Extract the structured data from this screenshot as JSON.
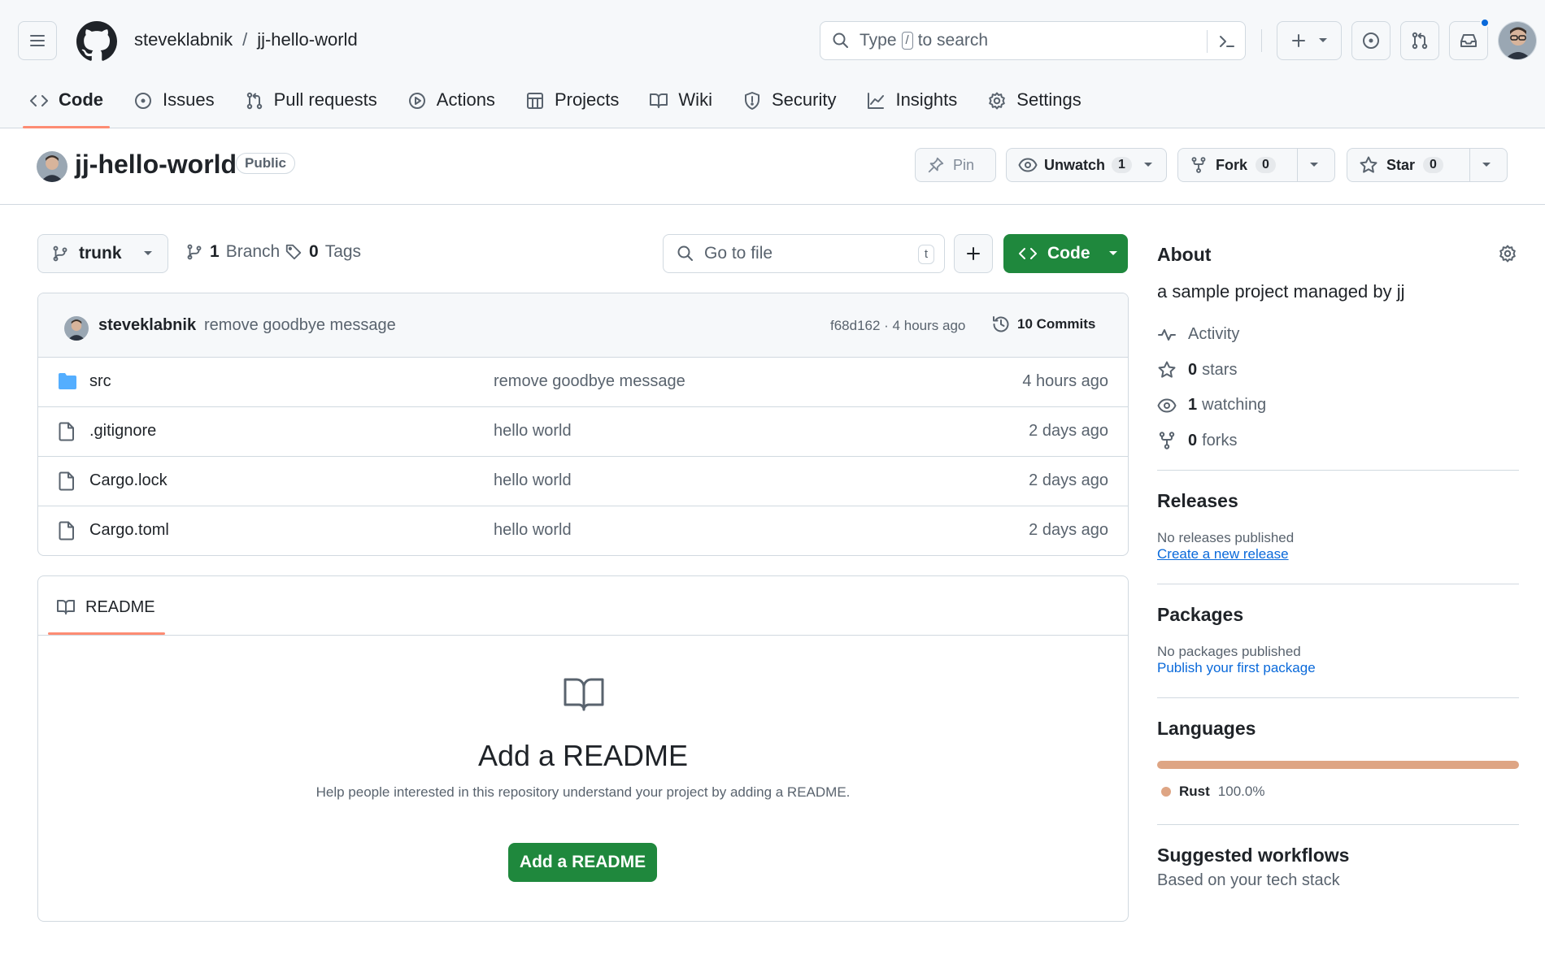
{
  "header": {
    "owner": "steveklabnik",
    "separator": "/",
    "repo": "jj-hello-world",
    "search": {
      "prefix": "Type",
      "key": "/",
      "suffix": "to search"
    }
  },
  "nav": {
    "items": [
      {
        "label": "Code",
        "icon": "code-icon",
        "active": true
      },
      {
        "label": "Issues",
        "icon": "issue-icon"
      },
      {
        "label": "Pull requests",
        "icon": "pull-request-icon"
      },
      {
        "label": "Actions",
        "icon": "play-icon"
      },
      {
        "label": "Projects",
        "icon": "table-icon"
      },
      {
        "label": "Wiki",
        "icon": "book-icon"
      },
      {
        "label": "Security",
        "icon": "shield-icon"
      },
      {
        "label": "Insights",
        "icon": "graph-icon"
      },
      {
        "label": "Settings",
        "icon": "gear-icon"
      }
    ]
  },
  "repo": {
    "name": "jj-hello-world",
    "visibility": "Public",
    "pin_label": "Pin",
    "watch_label": "Unwatch",
    "watch_count": "1",
    "fork_label": "Fork",
    "fork_count": "0",
    "star_label": "Star",
    "star_count": "0"
  },
  "toolbar": {
    "branch": "trunk",
    "branch_count": "1",
    "branch_word": "Branch",
    "tag_count": "0",
    "tag_word": "Tags",
    "goto_placeholder": "Go to file",
    "goto_key": "t",
    "code_label": "Code"
  },
  "latest_commit": {
    "author": "steveklabnik",
    "message": "remove goodbye message",
    "meta": "f68d162 · 4 hours ago",
    "commits_label": "10 Commits"
  },
  "files": [
    {
      "name": "src",
      "type": "folder",
      "message": "remove goodbye message",
      "date": "4 hours ago"
    },
    {
      "name": ".gitignore",
      "type": "file",
      "message": "hello world",
      "date": "2 days ago"
    },
    {
      "name": "Cargo.lock",
      "type": "file",
      "message": "hello world",
      "date": "2 days ago"
    },
    {
      "name": "Cargo.toml",
      "type": "file",
      "message": "hello world",
      "date": "2 days ago"
    }
  ],
  "readme": {
    "tab": "README",
    "title": "Add a README",
    "subtitle": "Help people interested in this repository understand your project by adding a README.",
    "button": "Add a README"
  },
  "about": {
    "title": "About",
    "description": "a sample project managed by jj",
    "activity": "Activity",
    "stars_count": "0",
    "stars_word": "stars",
    "watching_count": "1",
    "watching_word": "watching",
    "forks_count": "0",
    "forks_word": "forks"
  },
  "releases": {
    "title": "Releases",
    "empty": "No releases published",
    "link": "Create a new release"
  },
  "packages": {
    "title": "Packages",
    "empty": "No packages published",
    "link": "Publish your first package"
  },
  "languages": {
    "title": "Languages",
    "items": [
      {
        "name": "Rust",
        "percent": "100.0%",
        "color": "#dea584"
      }
    ]
  },
  "workflows": {
    "title": "Suggested workflows",
    "subtitle": "Based on your tech stack"
  },
  "colors": {
    "accent_green": "#1f883d",
    "link_blue": "#0969da",
    "tab_underline": "#fd8c73",
    "notification": "#0969da"
  }
}
